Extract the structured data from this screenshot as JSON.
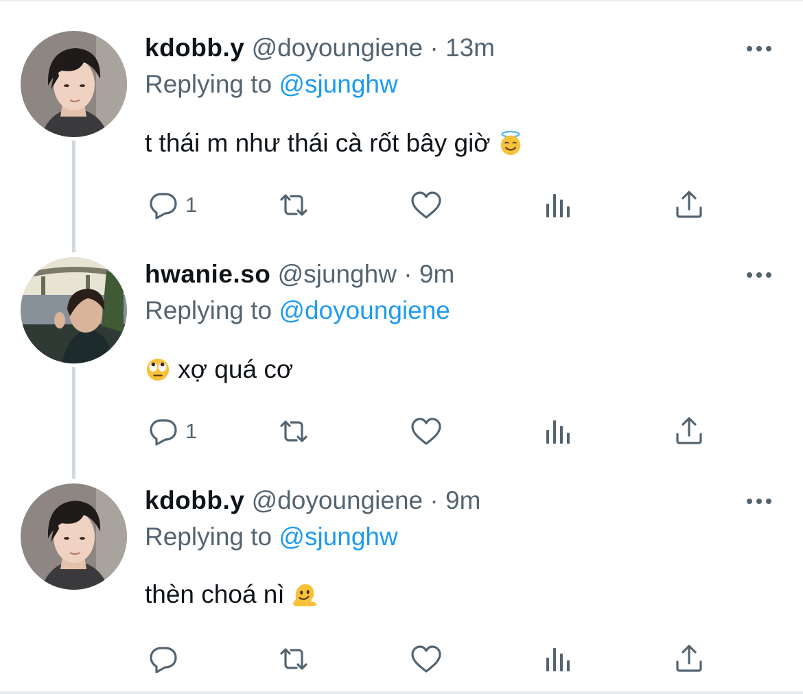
{
  "colors": {
    "text": "#0f1419",
    "secondary": "#536471",
    "accent": "#1d9bf0",
    "thread_line": "#cfd9de"
  },
  "tweets": [
    {
      "display_name": "kdobb.y",
      "handle": "@doyoungiene",
      "separator": "·",
      "time": "13m",
      "replying_prefix": "Replying to",
      "replying_to": "@sjunghw",
      "text": "t thái m như thái cà rốt bây giờ",
      "emoji": "smiling-face-with-halo",
      "reply_count": "1",
      "avatar": "kdobb-avatar"
    },
    {
      "display_name": "hwanie.so",
      "handle": "@sjunghw",
      "separator": "·",
      "time": "9m",
      "replying_prefix": "Replying to",
      "replying_to": "@doyoungiene",
      "text": "xợ quá cơ",
      "emoji": "face-with-rolling-eyes",
      "reply_count": "1",
      "avatar": "hwanie-avatar"
    },
    {
      "display_name": "kdobb.y",
      "handle": "@doyoungiene",
      "separator": "·",
      "time": "9m",
      "replying_prefix": "Replying to",
      "replying_to": "@sjunghw",
      "text": "thèn choá nì",
      "emoji": "melting-face",
      "reply_count": "",
      "avatar": "kdobb-avatar"
    }
  ],
  "icons": [
    "reply-icon",
    "retweet-icon",
    "like-icon",
    "views-icon",
    "share-icon",
    "more-icon"
  ]
}
